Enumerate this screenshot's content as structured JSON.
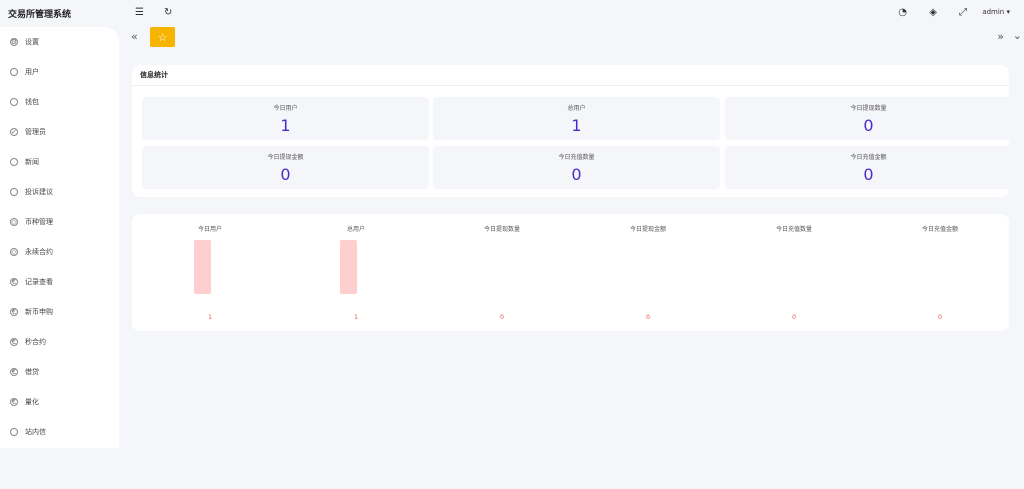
{
  "app_title": "交易所管理系统",
  "sidebar": {
    "items": [
      {
        "label": "设置",
        "icon": "gear-icon"
      },
      {
        "label": "用户",
        "icon": "user-icon"
      },
      {
        "label": "钱包",
        "icon": "wallet-icon"
      },
      {
        "label": "管理员",
        "icon": "shield-icon"
      },
      {
        "label": "新闻",
        "icon": "tag-icon"
      },
      {
        "label": "投诉建议",
        "icon": "handshake-icon"
      },
      {
        "label": "币种管理",
        "icon": "diamond-icon"
      },
      {
        "label": "永续合约",
        "icon": "diamond-icon"
      },
      {
        "label": "记录查看",
        "icon": "euro-icon"
      },
      {
        "label": "新币申购",
        "icon": "euro-icon"
      },
      {
        "label": "秒合约",
        "icon": "euro-icon"
      },
      {
        "label": "借贷",
        "icon": "euro-icon"
      },
      {
        "label": "量化",
        "icon": "euro-icon"
      },
      {
        "label": "站内信",
        "icon": "bell-icon"
      }
    ]
  },
  "topbar": {
    "admin_label": "admin"
  },
  "stats": {
    "title": "信息统计",
    "cards": [
      {
        "label": "今日用户",
        "value": "1"
      },
      {
        "label": "总用户",
        "value": "1"
      },
      {
        "label": "今日提现数量",
        "value": "0"
      },
      {
        "label": "今日提现金额",
        "value": "0"
      },
      {
        "label": "今日充值数量",
        "value": "0"
      },
      {
        "label": "今日充值金额",
        "value": "0"
      }
    ]
  },
  "chart_data": {
    "type": "bar",
    "categories": [
      "今日用户",
      "总用户",
      "今日提现数量",
      "今日提现金额",
      "今日充值数量",
      "今日充值金额"
    ],
    "values": [
      1,
      1,
      0,
      0,
      0,
      0
    ],
    "ylim": [
      0,
      1
    ],
    "grid": false,
    "bar_color": "#ffcfcf",
    "label_color": "#e84b4b"
  },
  "colors": {
    "accent": "#f7b500",
    "value": "#4a2bc9"
  }
}
